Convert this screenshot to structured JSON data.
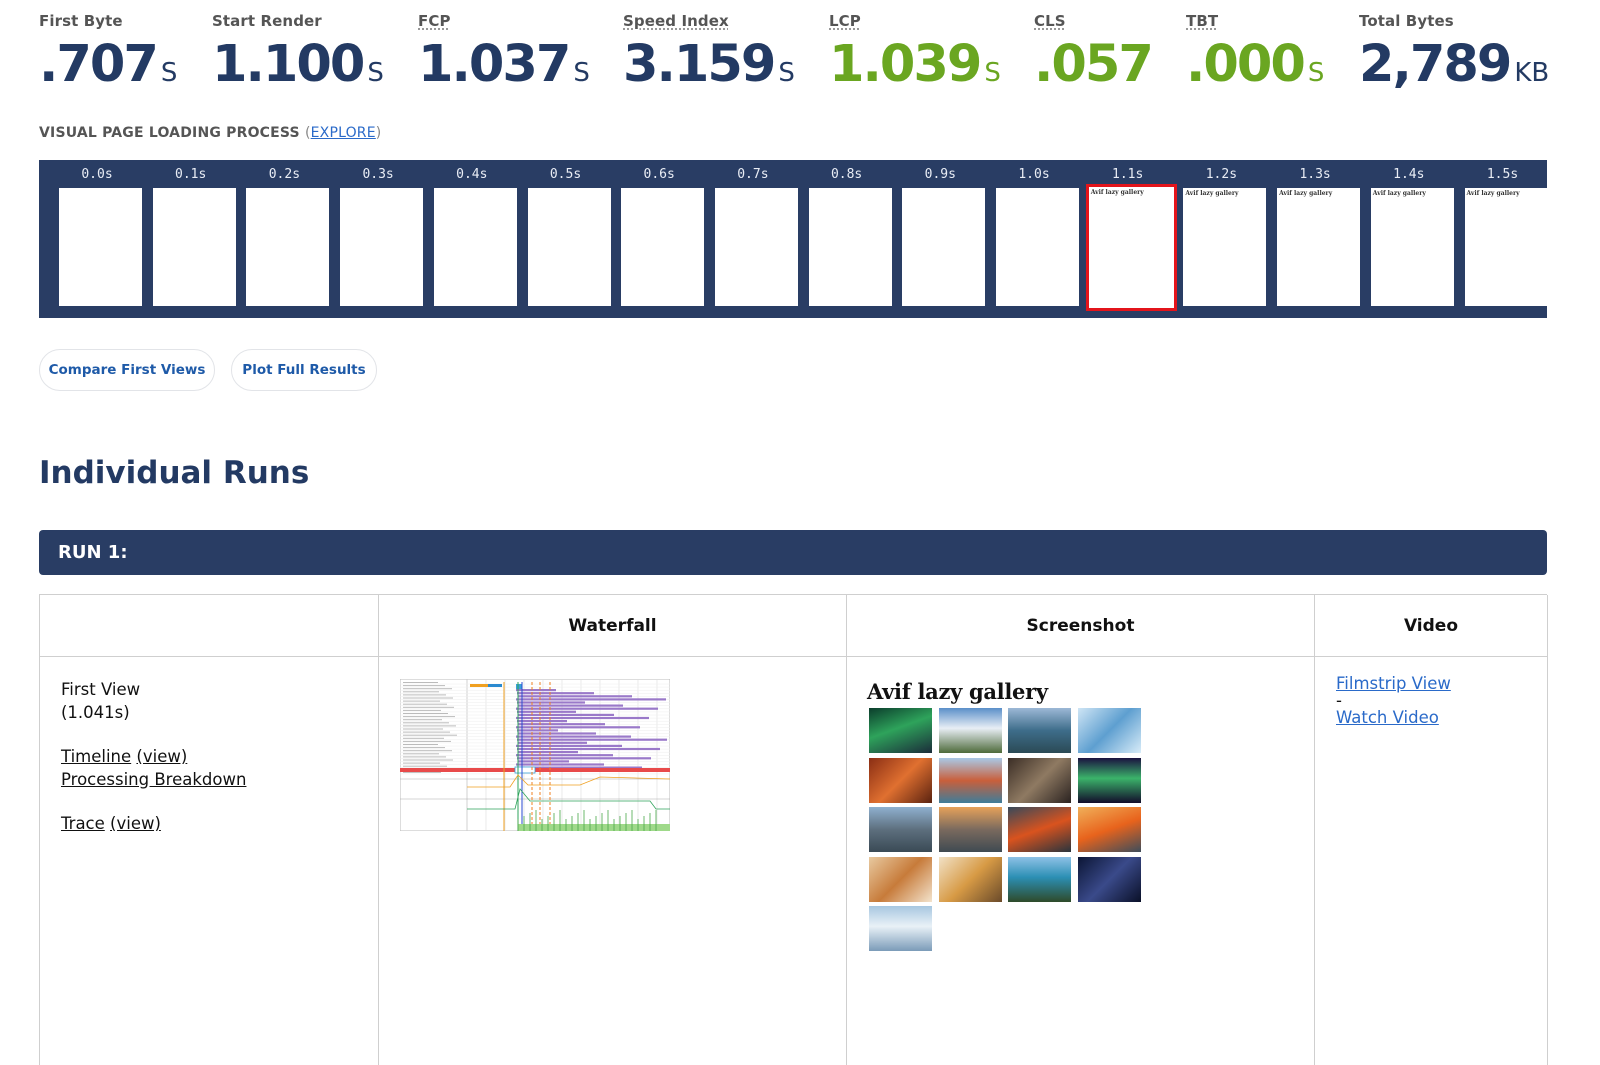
{
  "metrics": [
    {
      "label": "First Byte",
      "abbr": false,
      "value": ".707",
      "unit": "S",
      "good": false
    },
    {
      "label": "Start Render",
      "abbr": false,
      "value": "1.100",
      "unit": "S",
      "good": false
    },
    {
      "label": "FCP",
      "abbr": true,
      "value": "1.037",
      "unit": "S",
      "good": false
    },
    {
      "label": "Speed Index",
      "abbr": true,
      "value": "3.159",
      "unit": "S",
      "good": false
    },
    {
      "label": "LCP",
      "abbr": true,
      "value": "1.039",
      "unit": "S",
      "good": true
    },
    {
      "label": "CLS",
      "abbr": true,
      "value": ".057",
      "unit": "",
      "good": true
    },
    {
      "label": "TBT",
      "abbr": true,
      "value": ".000",
      "unit": "S",
      "good": true
    },
    {
      "label": "Total Bytes",
      "abbr": false,
      "value": "2,789",
      "unit": "KB",
      "good": false
    }
  ],
  "visual": {
    "heading": "VISUAL PAGE LOADING PROCESS",
    "paren_open": "(",
    "explore": "EXPLORE",
    "paren_close": ")"
  },
  "filmstrip": {
    "frames": [
      {
        "time": "0.0s",
        "text": "",
        "changed": false
      },
      {
        "time": "0.1s",
        "text": "",
        "changed": false
      },
      {
        "time": "0.2s",
        "text": "",
        "changed": false
      },
      {
        "time": "0.3s",
        "text": "",
        "changed": false
      },
      {
        "time": "0.4s",
        "text": "",
        "changed": false
      },
      {
        "time": "0.5s",
        "text": "",
        "changed": false
      },
      {
        "time": "0.6s",
        "text": "",
        "changed": false
      },
      {
        "time": "0.7s",
        "text": "",
        "changed": false
      },
      {
        "time": "0.8s",
        "text": "",
        "changed": false
      },
      {
        "time": "0.9s",
        "text": "",
        "changed": false
      },
      {
        "time": "1.0s",
        "text": "",
        "changed": false
      },
      {
        "time": "1.1s",
        "text": "Avif lazy gallery",
        "changed": true
      },
      {
        "time": "1.2s",
        "text": "Avif lazy gallery",
        "changed": false
      },
      {
        "time": "1.3s",
        "text": "Avif lazy gallery",
        "changed": false
      },
      {
        "time": "1.4s",
        "text": "Avif lazy gallery",
        "changed": false
      },
      {
        "time": "1.5s",
        "text": "Avif lazy gallery",
        "changed": false
      }
    ],
    "changed_color": "#e3141b"
  },
  "buttons": {
    "compare": "Compare First Views",
    "plot": "Plot Full Results"
  },
  "section_title": "Individual Runs",
  "run": {
    "label": "RUN 1:",
    "columns": {
      "waterfall": "Waterfall",
      "screenshot": "Screenshot",
      "video": "Video"
    },
    "first_view": {
      "label": "First View",
      "time": "(1.041s)",
      "timeline": "Timeline",
      "timeline_view": "(view)",
      "processing": "Processing Breakdown",
      "trace": "Trace",
      "trace_view": "(view)"
    },
    "screenshot_title": "Avif lazy gallery",
    "video": {
      "filmstrip": "Filmstrip View",
      "dash": "-",
      "watch": "Watch Video"
    }
  },
  "colors": {
    "navy": "#233a63",
    "bar": "#293d64",
    "good": "#6aa621",
    "link": "#2a6ac9"
  }
}
